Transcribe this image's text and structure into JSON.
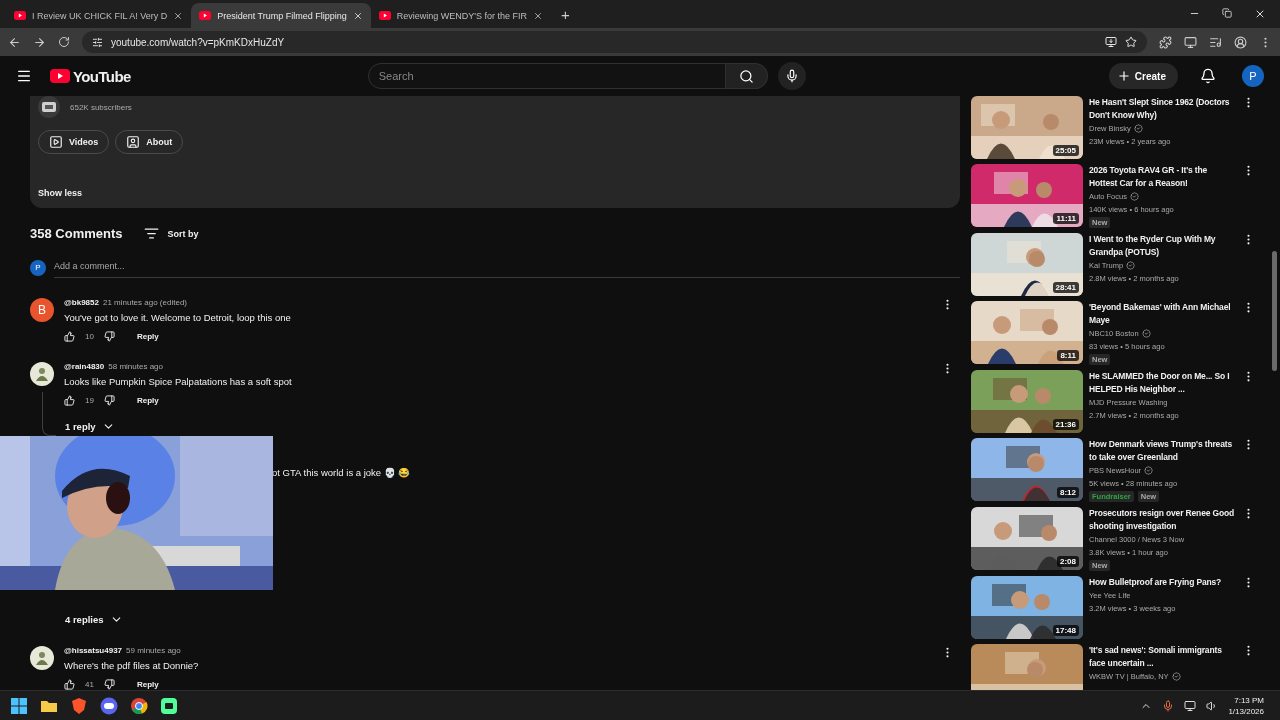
{
  "browser": {
    "tabs": [
      {
        "title": "I Review UK CHICK FIL A! Very D",
        "selected": false
      },
      {
        "title": "President Trump Filmed Flipping",
        "selected": true
      },
      {
        "title": "Reviewing WENDY'S for the FIR",
        "selected": false
      }
    ],
    "new_tab": "+",
    "url": "youtube.com/watch?v=pKmKDxHuZdY"
  },
  "header": {
    "logo": "YouTube",
    "search": {
      "placeholder": "Search"
    },
    "create": "Create",
    "avatar": "P"
  },
  "channel_card": {
    "subscribers": "652K subscribers",
    "buttons": [
      {
        "kind": "videos",
        "label": "Videos"
      },
      {
        "kind": "about",
        "label": "About"
      }
    ],
    "show_less": "Show less"
  },
  "comments": {
    "count": "358 Comments",
    "sort": "Sort by",
    "add": {
      "avatar": "P",
      "placeholder": "Add a comment..."
    },
    "items": [
      {
        "kind": "full",
        "avatar": {
          "kind": "letter",
          "text": "B"
        },
        "author": "@bk9852",
        "time": "21 minutes ago (edited)",
        "text": "You've got to love it. Welcome to Detroit, loop this one",
        "likes": "10",
        "reply": "Reply"
      },
      {
        "kind": "full",
        "author": "@rain4830",
        "time": "58 minutes ago",
        "text": "Looks like Pumpkin Spice Palpatations has a soft spot",
        "likes": "19",
        "reply": "Reply",
        "replies": "1 reply"
      },
      {
        "kind": "partial",
        "text": "ot GTA this world is a joke 💀 😂",
        "replies": "4 replies"
      },
      {
        "kind": "full",
        "author": "@hissatsu4937",
        "time": "59 minutes ago",
        "text": "Where's the pdf files at Donnie?",
        "likes": "41",
        "reply": "Reply"
      }
    ]
  },
  "sidebar": [
    {
      "title": "He Hasn't Slept Since 1962 (Doctors Don't Know Why)",
      "channel": "Drew Binsky",
      "verified": true,
      "views": "23M views • 2 years ago",
      "duration": "25:05"
    },
    {
      "title": "2026 Toyota RAV4 GR - It's the Hottest Car for a Reason!",
      "channel": "Auto Focus",
      "verified": true,
      "views": "140K views • 6 hours ago",
      "badges": [
        {
          "kind": "new",
          "label": "New"
        }
      ],
      "duration": "11:11"
    },
    {
      "title": "I Went to the Ryder Cup With My Grandpa (POTUS)",
      "channel": "Kai Trump",
      "verified": true,
      "views": "2.8M views • 2 months ago",
      "duration": "28:41"
    },
    {
      "title": "'Beyond Bakemas' with Ann Michael Maye",
      "channel": "NBC10 Boston",
      "verified": true,
      "views": "83 views • 5 hours ago",
      "badges": [
        {
          "kind": "new",
          "label": "New"
        }
      ],
      "duration": "8:11"
    },
    {
      "title": "He SLAMMED the Door on Me... So I HELPED His Neighbor ...",
      "channel": "MJD Pressure Washing",
      "verified": false,
      "views": "2.7M views • 2 months ago",
      "duration": "21:36"
    },
    {
      "title": "How Denmark views Trump's threats to take over Greenland",
      "channel": "PBS NewsHour",
      "verified": true,
      "views": "5K views • 28 minutes ago",
      "badges": [
        {
          "kind": "fundraiser",
          "label": "Fundraiser"
        },
        {
          "kind": "new",
          "label": "New"
        }
      ],
      "duration": "8:12"
    },
    {
      "title": "Prosecutors resign over Renee Good shooting investigation",
      "channel": "Channel 3000 / News 3 Now",
      "verified": false,
      "views": "3.8K views • 1 hour ago",
      "badges": [
        {
          "kind": "new",
          "label": "New"
        }
      ],
      "duration": "2:08"
    },
    {
      "title": "How Bulletproof are Frying Pans?",
      "channel": "Yee Yee Life",
      "verified": false,
      "views": "3.2M views • 3 weeks ago",
      "duration": "17:48"
    },
    {
      "title": "'It's sad news': Somali immigrants face uncertain ...",
      "channel": "WKBW TV | Buffalo, NY",
      "verified": true
    }
  ],
  "taskbar": {
    "time": "7:13 PM",
    "date": "1/13/2026"
  }
}
